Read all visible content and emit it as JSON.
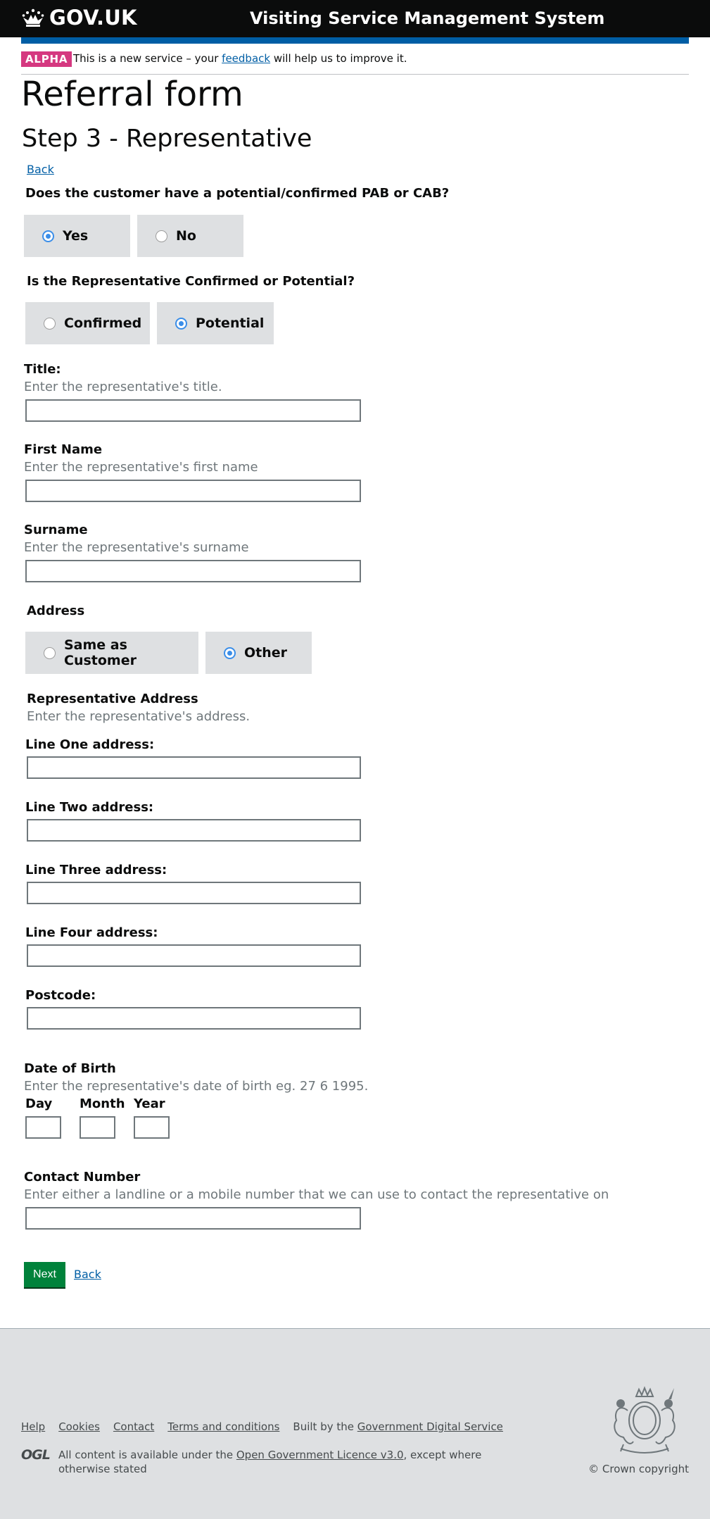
{
  "header": {
    "logo_text": "GOV.UK",
    "service_name": "Visiting Service Management System"
  },
  "phase_banner": {
    "tag": "ALPHA",
    "text_before": "This is a new service – your ",
    "feedback_link": "feedback",
    "text_after": " will help us to improve it."
  },
  "page": {
    "title": "Referral form",
    "step_title": "Step 3 - Representative",
    "back_top": "Back"
  },
  "pab_question": {
    "label": "Does the customer have a potential/confirmed PAB or CAB?",
    "options": [
      {
        "label": "Yes",
        "checked": true
      },
      {
        "label": "No",
        "checked": false
      }
    ]
  },
  "rep_status_question": {
    "label": "Is the Representative Confirmed or Potential?",
    "options": [
      {
        "label": "Confirmed",
        "checked": false
      },
      {
        "label": "Potential",
        "checked": true
      }
    ]
  },
  "title_field": {
    "label": "Title:",
    "hint": "Enter the representative's title.",
    "value": ""
  },
  "first_name_field": {
    "label": "First Name",
    "hint": "Enter the representative's first name",
    "value": ""
  },
  "surname_field": {
    "label": "Surname",
    "hint": "Enter the representative's surname",
    "value": ""
  },
  "address_question": {
    "label": "Address",
    "options": [
      {
        "label": "Same as Customer",
        "checked": false
      },
      {
        "label": "Other",
        "checked": true
      }
    ]
  },
  "rep_address": {
    "heading": "Representative Address",
    "hint": "Enter the representative's address.",
    "line1_label": "Line One address:",
    "line2_label": "Line Two address:",
    "line3_label": "Line Three address:",
    "line4_label": "Line Four address:",
    "postcode_label": "Postcode:"
  },
  "dob": {
    "label": "Date of Birth",
    "hint": "Enter the representative's date of birth eg. 27 6 1995.",
    "day_label": "Day",
    "month_label": "Month",
    "year_label": "Year"
  },
  "contact": {
    "label": "Contact Number",
    "hint": "Enter either a landline or a mobile number that we can use to contact the representative on",
    "value": ""
  },
  "actions": {
    "next_label": "Next",
    "back_label": "Back"
  },
  "footer": {
    "links": [
      "Help",
      "Cookies",
      "Contact",
      "Terms and conditions"
    ],
    "built_by_text": "Built by the ",
    "built_by_link": "Government Digital Service",
    "ogl_logo": "OGL",
    "licence_before": "All content is available under the ",
    "licence_link": "Open Government Licence v3.0",
    "licence_after": ", except where otherwise stated",
    "copyright": "© Crown copyright"
  },
  "colors": {
    "header_bg": "#0b0c0c",
    "blue_bar": "#005ea5",
    "alpha_tag": "#d53880",
    "radio_block_bg": "#dee0e2",
    "radio_checked": "#3b8ee8",
    "next_button": "#00823b",
    "link": "#005ea5",
    "footer_bg": "#dee0e2"
  },
  "icons": {
    "logo": "crown-icon",
    "footer_crest": "royal-coat-of-arms-icon"
  }
}
